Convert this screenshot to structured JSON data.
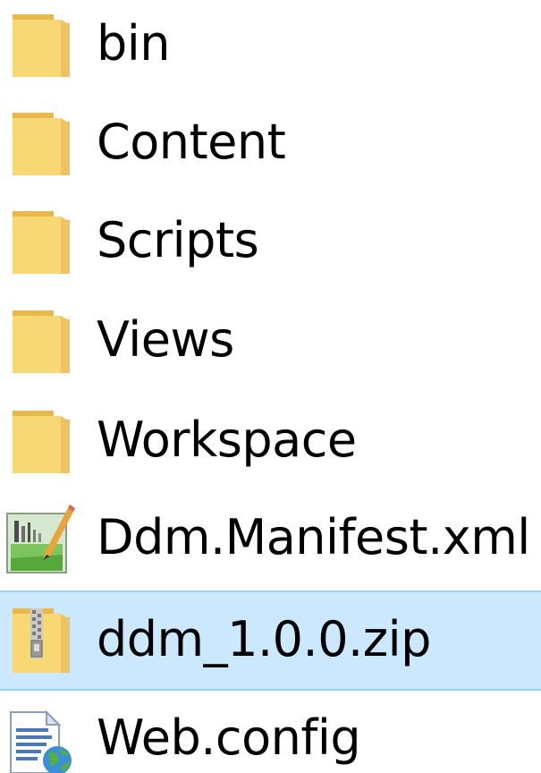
{
  "explorer": {
    "items": [
      {
        "name": "bin",
        "type": "folder",
        "icon": "folder-icon",
        "selected": false
      },
      {
        "name": "Content",
        "type": "folder",
        "icon": "folder-icon",
        "selected": false
      },
      {
        "name": "Scripts",
        "type": "folder",
        "icon": "folder-icon",
        "selected": false
      },
      {
        "name": "Views",
        "type": "folder",
        "icon": "folder-icon",
        "selected": false
      },
      {
        "name": "Workspace",
        "type": "folder",
        "icon": "folder-icon",
        "selected": false
      },
      {
        "name": "Ddm.Manifest.xml",
        "type": "xml",
        "icon": "xml-file-icon",
        "selected": false
      },
      {
        "name": "ddm_1.0.0.zip",
        "type": "zip",
        "icon": "zip-archive-icon",
        "selected": true
      },
      {
        "name": "Web.config",
        "type": "config",
        "icon": "config-file-icon",
        "selected": false
      }
    ]
  },
  "colors": {
    "folder": "#f8d775",
    "folder_dark": "#e8b84a",
    "selection_bg": "#cce8ff",
    "selection_border": "#99d1ff"
  }
}
